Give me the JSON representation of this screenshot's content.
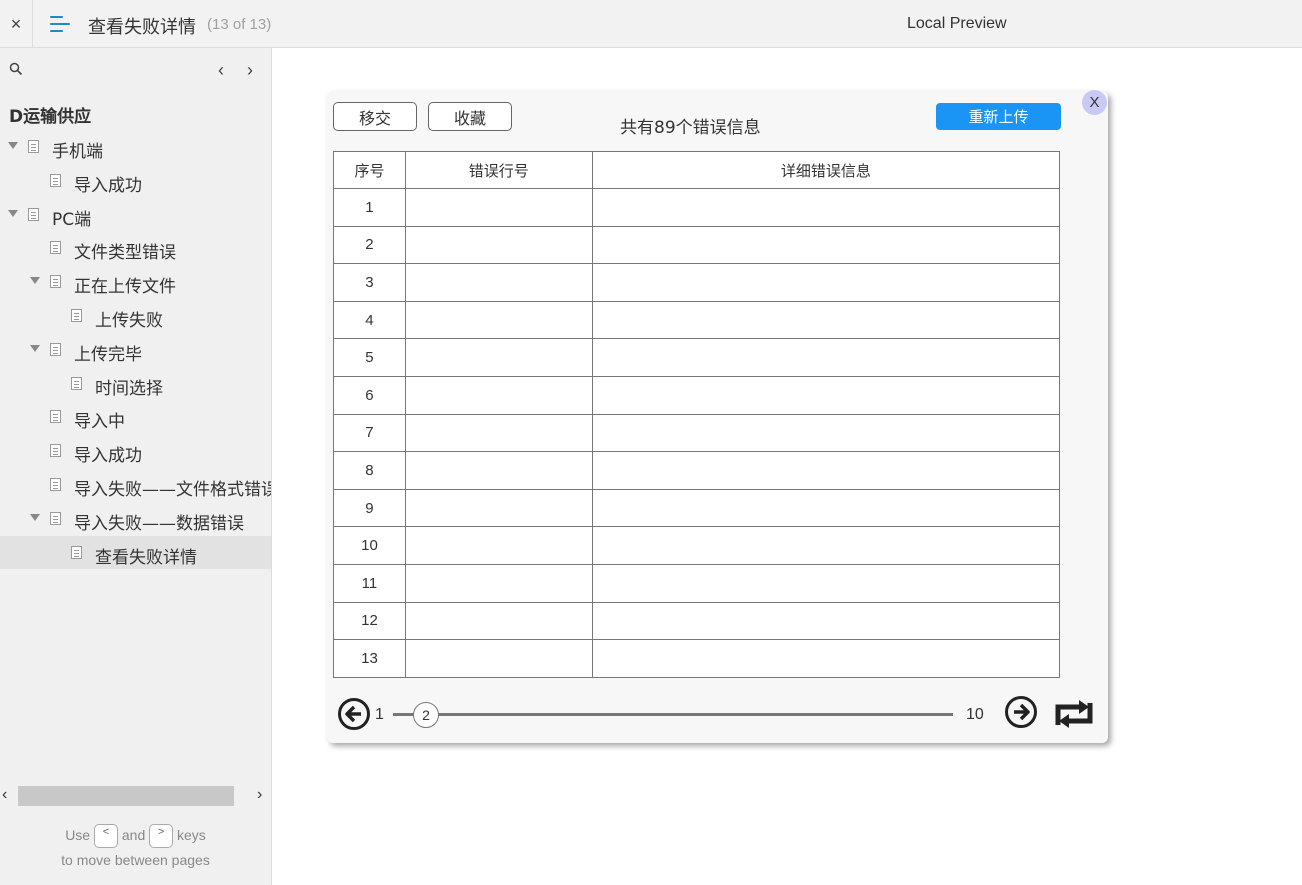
{
  "topbar": {
    "close": "×",
    "title": "查看失败详情",
    "count": "(13 of 13)",
    "preview": "Local Preview"
  },
  "sidebar": {
    "project": "D运输供应",
    "items": [
      {
        "label": "手机端",
        "level": 0,
        "expanded": true
      },
      {
        "label": "导入成功",
        "level": 1,
        "expanded": null
      },
      {
        "label": "PC端",
        "level": 0,
        "expanded": true
      },
      {
        "label": "文件类型错误",
        "level": 1,
        "expanded": null
      },
      {
        "label": "正在上传文件",
        "level": 1,
        "expanded": true
      },
      {
        "label": "上传失败",
        "level": 2,
        "expanded": null
      },
      {
        "label": "上传完毕",
        "level": 1,
        "expanded": true
      },
      {
        "label": "时间选择",
        "level": 2,
        "expanded": null
      },
      {
        "label": "导入中",
        "level": 1,
        "expanded": null
      },
      {
        "label": "导入成功",
        "level": 1,
        "expanded": null
      },
      {
        "label": "导入失败——文件格式错误",
        "level": 1,
        "expanded": null
      },
      {
        "label": "导入失败——数据错误",
        "level": 1,
        "expanded": true
      },
      {
        "label": "查看失败详情",
        "level": 2,
        "expanded": null,
        "active": true
      }
    ],
    "hint": {
      "use": "Use",
      "and": "and",
      "keys": "keys",
      "line2": "to move between pages",
      "key_prev": "<",
      "key_next": ">"
    }
  },
  "dialog": {
    "close": "X",
    "btn_transfer": "移交",
    "btn_favorite": "收藏",
    "title": "共有89个错误信息",
    "btn_reupload": "重新上传",
    "columns": [
      "序号",
      "错误行号",
      "详细错误信息"
    ],
    "rows": [
      "1",
      "2",
      "3",
      "4",
      "5",
      "6",
      "7",
      "8",
      "9",
      "10",
      "11",
      "12",
      "13"
    ],
    "pager": {
      "first": "1",
      "current": "2",
      "last": "10"
    }
  },
  "colors": {
    "accent": "#1a95f5",
    "menu_icon": "#1e88c8",
    "close_badge": "#c9c9f5"
  }
}
